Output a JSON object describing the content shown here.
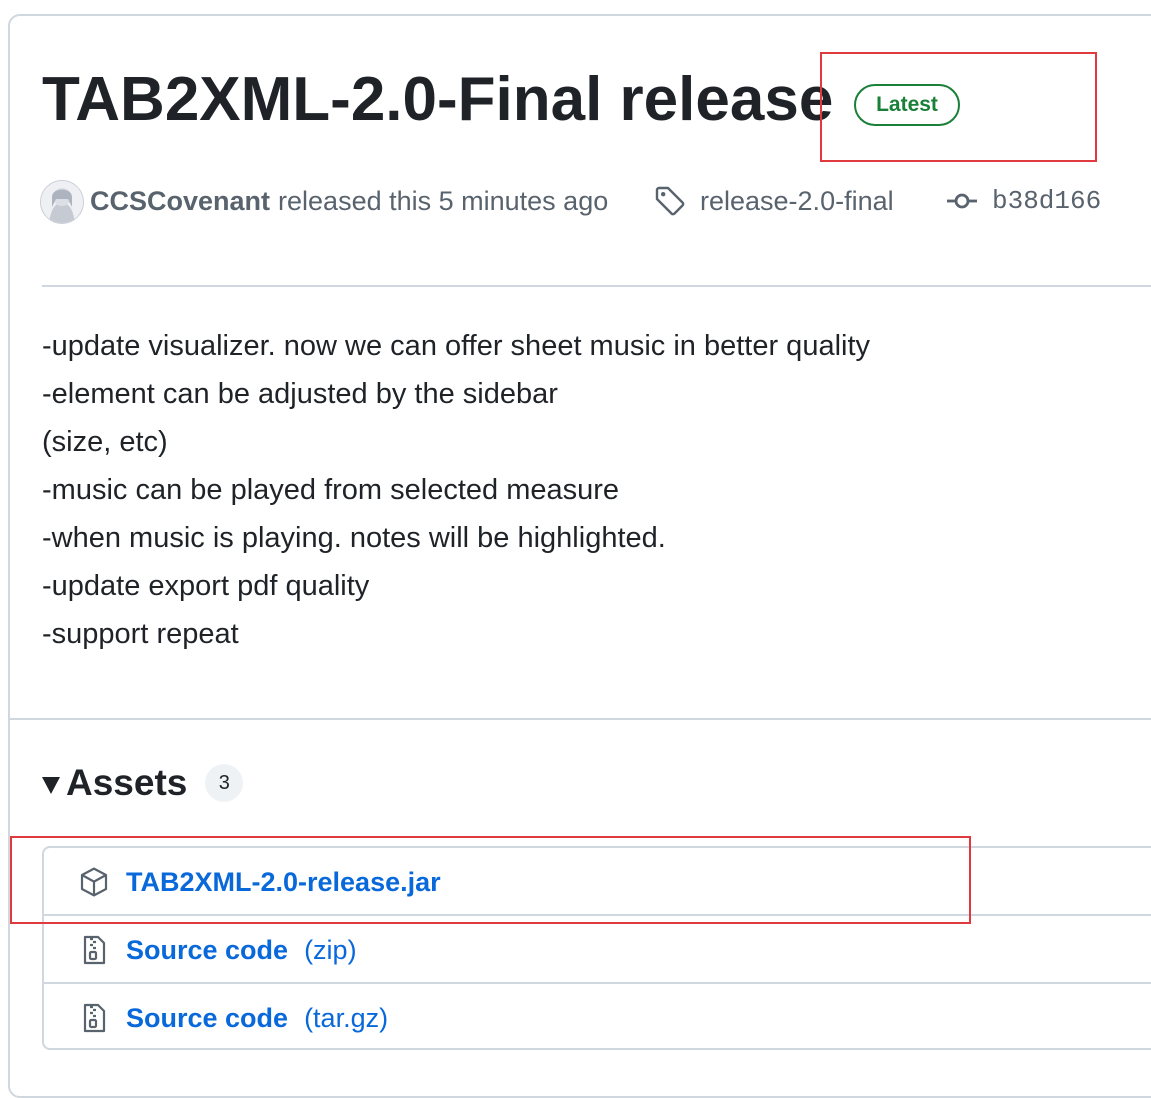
{
  "release": {
    "title": "TAB2XML-2.0-Final release",
    "badge": "Latest",
    "author": "CCSCovenant",
    "released_text": "released this 5 minutes ago",
    "tag": "release-2.0-final",
    "commit": "b38d166",
    "notes": [
      "-update visualizer. now we can offer sheet music in better quality",
      "-element can be adjusted by the sidebar",
      "(size, etc)",
      "-music can be played from selected measure",
      "-when music is playing. notes will be highlighted.",
      "-update export pdf quality",
      "-support repeat"
    ]
  },
  "assets": {
    "label": "Assets",
    "count": "3",
    "items": [
      {
        "name": "TAB2XML-2.0-release.jar",
        "ext": "",
        "icon": "package-icon"
      },
      {
        "name": "Source code",
        "ext": "(zip)",
        "icon": "file-zip-icon"
      },
      {
        "name": "Source code",
        "ext": "(tar.gz)",
        "icon": "file-zip-icon"
      }
    ]
  },
  "colors": {
    "accent_link": "#0969da",
    "badge_green": "#1a7f37",
    "annotation_red": "#e03a3e",
    "border": "#d0d7de"
  }
}
